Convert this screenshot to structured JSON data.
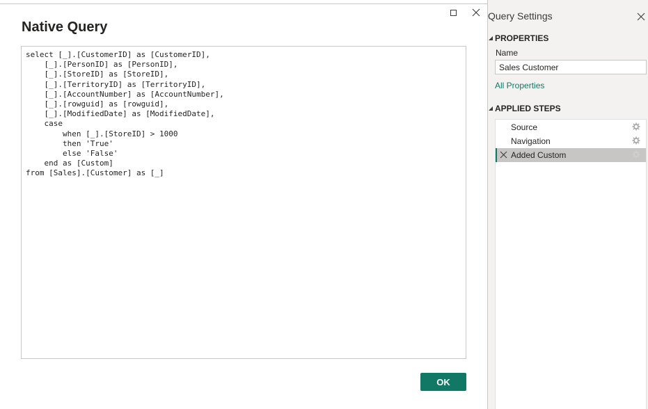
{
  "dialog": {
    "title": "Native Query",
    "query": "select [_].[CustomerID] as [CustomerID],\n    [_].[PersonID] as [PersonID],\n    [_].[StoreID] as [StoreID],\n    [_].[TerritoryID] as [TerritoryID],\n    [_].[AccountNumber] as [AccountNumber],\n    [_].[rowguid] as [rowguid],\n    [_].[ModifiedDate] as [ModifiedDate],\n    case\n        when [_].[StoreID] > 1000\n        then 'True'\n        else 'False'\n    end as [Custom]\nfrom [Sales].[Customer] as [_]",
    "ok_label": "OK",
    "icons": {
      "maximize": "maximize-icon",
      "close": "close-icon"
    }
  },
  "query_settings": {
    "title": "Query Settings",
    "properties_header": "PROPERTIES",
    "name_label": "Name",
    "name_value": "Sales Customer",
    "all_properties_label": "All Properties",
    "applied_steps_header": "APPLIED STEPS",
    "steps": [
      {
        "label": "Source",
        "selected": false
      },
      {
        "label": "Navigation",
        "selected": false
      },
      {
        "label": "Added Custom",
        "selected": true
      }
    ]
  },
  "colors": {
    "accent": "#117865",
    "pane_background": "#f3f2f1",
    "selected_step": "#c8c6c4"
  }
}
